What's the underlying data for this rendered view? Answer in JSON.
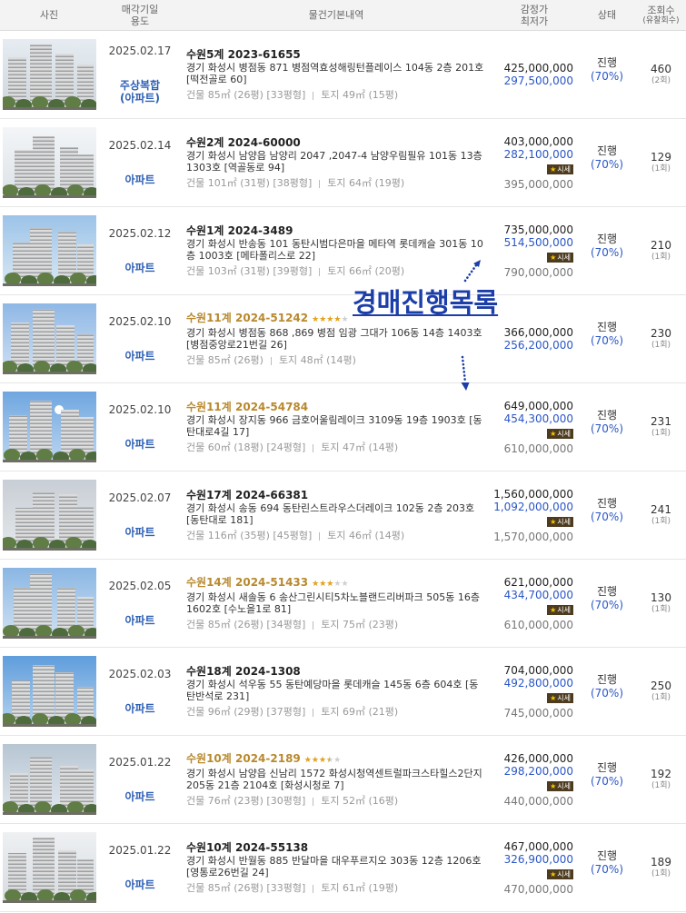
{
  "header": {
    "photo": "사진",
    "date_line1": "매각기일",
    "date_line2": "용도",
    "detail": "물건기본내역",
    "price_line1": "감정가",
    "price_line2": "최저가",
    "status": "상태",
    "views_line1": "조회수",
    "views_line2": "(유찰회수)"
  },
  "overlay": {
    "label": "경매진행목록"
  },
  "badge_label": "시세",
  "star_max": 5,
  "colors": {
    "usage": "#2d5fb5",
    "hl": "#b8892e",
    "minp": "#2a56c6",
    "overlay": "#1c3ea8",
    "star": "#e3a21a"
  },
  "items": [
    {
      "date": "2025.02.17",
      "usage": [
        "주상복합",
        "(아파트)"
      ],
      "case": "수원5계 2023-61655",
      "highlight": false,
      "stars": null,
      "address": "경기 화성시 병점동 871 병점역효성해링턴플레이스 104동 2층 201호 [떡전골로 60]",
      "building": "건물 85㎡ (26평) [33평형]",
      "land": "토지 49㎡ (15평)",
      "appraisal": "425,000,000",
      "minimum": "297,500,000",
      "market": null,
      "status": "진행",
      "ratio": "(70%)",
      "views": "460",
      "fail": "(2회)"
    },
    {
      "date": "2025.02.14",
      "usage": [
        "아파트"
      ],
      "case": "수원2계 2024-60000",
      "highlight": false,
      "stars": null,
      "address": "경기 화성시 남양읍 남양리 2047 ,2047-4 남양우림필유 101동 13층 1303호 [역골동로 94]",
      "building": "건물 101㎡ (31평) [38평형]",
      "land": "토지 64㎡ (19평)",
      "appraisal": "403,000,000",
      "minimum": "282,100,000",
      "market": "395,000,000",
      "status": "진행",
      "ratio": "(70%)",
      "views": "129",
      "fail": "(1회)"
    },
    {
      "date": "2025.02.12",
      "usage": [
        "아파트"
      ],
      "case": "수원1계 2024-3489",
      "highlight": false,
      "stars": null,
      "address": "경기 화성시 반송동 101 동탄시범다은마을 메타역 롯데캐슬 301동 10층 1003호 [메타폴리스로 22]",
      "building": "건물 103㎡ (31평) [39평형]",
      "land": "토지 66㎡ (20평)",
      "appraisal": "735,000,000",
      "minimum": "514,500,000",
      "market": "790,000,000",
      "status": "진행",
      "ratio": "(70%)",
      "views": "210",
      "fail": "(1회)"
    },
    {
      "date": "2025.02.10",
      "usage": [
        "아파트"
      ],
      "case": "수원11계 2024-51242",
      "highlight": true,
      "stars": 4,
      "address": "경기 화성시 병점동 868 ,869 병점 임광 그대가 106동 14층 1403호 [병점중앙로21번길 26]",
      "building": "건물 85㎡ (26평)",
      "land": "토지 48㎡ (14평)",
      "appraisal": "366,000,000",
      "minimum": "256,200,000",
      "market": null,
      "status": "진행",
      "ratio": "(70%)",
      "views": "230",
      "fail": "(1회)"
    },
    {
      "date": "2025.02.10",
      "usage": [
        "아파트"
      ],
      "case": "수원11계 2024-54784",
      "highlight": true,
      "stars": null,
      "address": "경기 화성시 장지동 966 금호어울림레이크 3109동 19층 1903호 [동탄대로4길 17]",
      "building": "건물 60㎡ (18평) [24평형]",
      "land": "토지 47㎡ (14평)",
      "appraisal": "649,000,000",
      "minimum": "454,300,000",
      "market": "610,000,000",
      "status": "진행",
      "ratio": "(70%)",
      "views": "231",
      "fail": "(1회)"
    },
    {
      "date": "2025.02.07",
      "usage": [
        "아파트"
      ],
      "case": "수원17계 2024-66381",
      "highlight": false,
      "stars": null,
      "address": "경기 화성시 송동 694 동탄린스트라우스더레이크 102동 2층 203호 [동탄대로 181]",
      "building": "건물 116㎡ (35평) [45평형]",
      "land": "토지 46㎡ (14평)",
      "appraisal": "1,560,000,000",
      "minimum": "1,092,000,000",
      "market": "1,570,000,000",
      "status": "진행",
      "ratio": "(70%)",
      "views": "241",
      "fail": "(1회)"
    },
    {
      "date": "2025.02.05",
      "usage": [
        "아파트"
      ],
      "case": "수원14계 2024-51433",
      "highlight": true,
      "stars": 3,
      "address": "경기 화성시 새솔동 6 송산그린시티5차노블랜드리버파크 505동 16층 1602호 [수노을1로 81]",
      "building": "건물 85㎡ (26평) [34평형]",
      "land": "토지 75㎡ (23평)",
      "appraisal": "621,000,000",
      "minimum": "434,700,000",
      "market": "610,000,000",
      "status": "진행",
      "ratio": "(70%)",
      "views": "130",
      "fail": "(1회)"
    },
    {
      "date": "2025.02.03",
      "usage": [
        "아파트"
      ],
      "case": "수원18계 2024-1308",
      "highlight": false,
      "stars": null,
      "address": "경기 화성시 석우동 55 동탄예당마을 롯데캐슬 145동 6층 604호 [동탄반석로 231]",
      "building": "건물 96㎡ (29평) [37평형]",
      "land": "토지 69㎡ (21평)",
      "appraisal": "704,000,000",
      "minimum": "492,800,000",
      "market": "745,000,000",
      "status": "진행",
      "ratio": "(70%)",
      "views": "250",
      "fail": "(1회)"
    },
    {
      "date": "2025.01.22",
      "usage": [
        "아파트"
      ],
      "case": "수원10계 2024-2189",
      "highlight": true,
      "stars": 3.5,
      "address": "경기 화성시 남양읍 신남리 1572 화성시청역센트럴파크스타힐스2단지 205동 21층 2104호 [화성시청로 7]",
      "building": "건물 76㎡ (23평) [30평형]",
      "land": "토지 52㎡ (16평)",
      "appraisal": "426,000,000",
      "minimum": "298,200,000",
      "market": "440,000,000",
      "status": "진행",
      "ratio": "(70%)",
      "views": "192",
      "fail": "(1회)"
    },
    {
      "date": "2025.01.22",
      "usage": [
        "아파트"
      ],
      "case": "수원10계 2024-55138",
      "highlight": false,
      "stars": null,
      "address": "경기 화성시 반월동 885 반달마을 대우푸르지오 303동 12층 1206호 [영통로26번길 24]",
      "building": "건물 85㎡ (26평) [33평형]",
      "land": "토지 61㎡ (19평)",
      "appraisal": "467,000,000",
      "minimum": "326,900,000",
      "market": "470,000,000",
      "status": "진행",
      "ratio": "(70%)",
      "views": "189",
      "fail": "(1회)"
    }
  ]
}
